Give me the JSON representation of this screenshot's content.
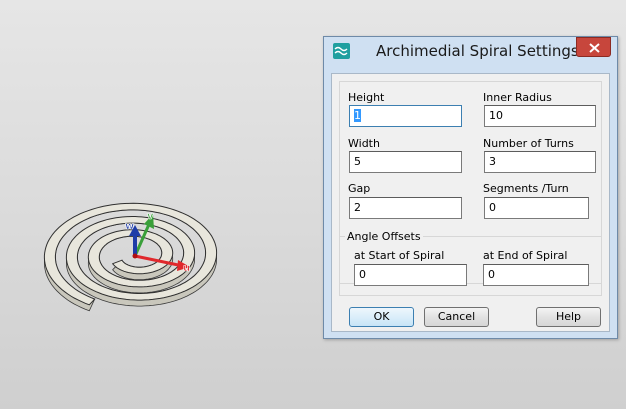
{
  "dialog": {
    "title": "Archimedial Spiral Settings",
    "icon": "app-wave-icon",
    "close_icon": "close-icon",
    "fields": {
      "height": {
        "label": "Height",
        "value": "1"
      },
      "inner_radius": {
        "label": "Inner Radius",
        "value": "10"
      },
      "width": {
        "label": "Width",
        "value": "5"
      },
      "number_of_turns": {
        "label": "Number of Turns",
        "value": "3"
      },
      "gap": {
        "label": "Gap",
        "value": "2"
      },
      "segments_per_turn": {
        "label": "Segments /Turn",
        "value": "0"
      }
    },
    "angle_offsets": {
      "title": "Angle Offsets",
      "start": {
        "label": "at Start of Spiral",
        "value": "0"
      },
      "end": {
        "label": "at End of Spiral",
        "value": "0"
      }
    },
    "buttons": {
      "ok": "OK",
      "cancel": "Cancel",
      "help": "Help"
    }
  },
  "viewport": {
    "axis_labels": {
      "u": "u",
      "v": "v",
      "w": "w"
    },
    "axis_colors": {
      "u": "#e0282c",
      "v": "#3aa03a",
      "w": "#1e3ca8"
    },
    "model_color": "#e8e6dc"
  }
}
